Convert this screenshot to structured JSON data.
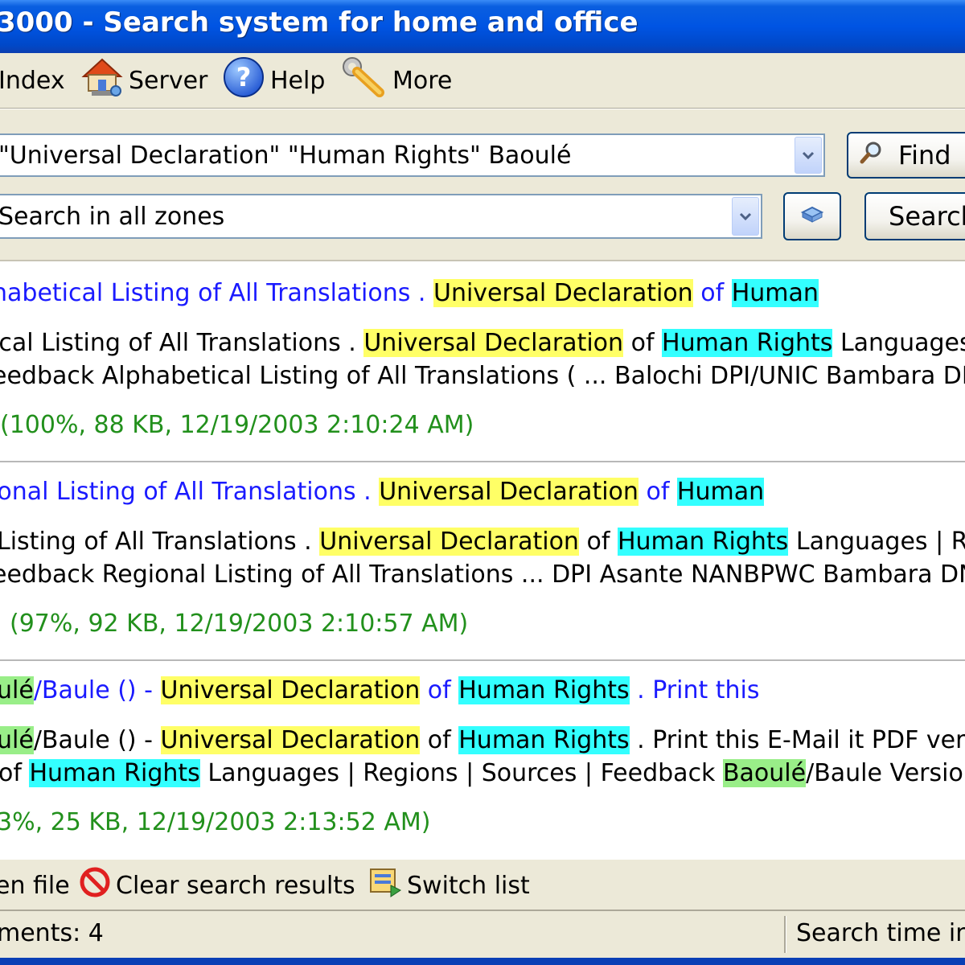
{
  "window": {
    "title": "3000 - Search system for home and office"
  },
  "toolbar": {
    "index_label": "Index",
    "server_label": "Server",
    "help_label": "Help",
    "more_label": "More"
  },
  "search": {
    "query": "\"Universal Declaration\" \"Human Rights\" Baoulé",
    "find_label": "Find",
    "zone": "Search in all zones",
    "search_label": "Search"
  },
  "results": [
    {
      "title": [
        {
          "t": "habetical Listing of All Translations . ",
          "h": ""
        },
        {
          "t": "Universal Declaration",
          "h": "y"
        },
        {
          "t": " of ",
          "h": ""
        },
        {
          "t": "Human",
          "h": "c"
        }
      ],
      "snippet1": [
        {
          "t": "ical Listing of All Translations . ",
          "h": ""
        },
        {
          "t": "Universal Declaration",
          "h": "y"
        },
        {
          "t": " of ",
          "h": ""
        },
        {
          "t": "Human Rights",
          "h": "c"
        },
        {
          "t": " Languages",
          "h": ""
        }
      ],
      "snippet2": [
        {
          "t": "eedback Alphabetical Listing of All Translations ( ... Balochi DPI/UNIC Bambara DN",
          "h": ""
        }
      ],
      "meta": "(100%, 88 KB, 12/19/2003 2:10:24 AM)"
    },
    {
      "title": [
        {
          "t": "ional Listing of All Translations . ",
          "h": ""
        },
        {
          "t": "Universal Declaration",
          "h": "y"
        },
        {
          "t": " of ",
          "h": ""
        },
        {
          "t": "Human",
          "h": "c"
        }
      ],
      "snippet1": [
        {
          "t": "Listing of All Translations . ",
          "h": ""
        },
        {
          "t": "Universal Declaration",
          "h": "y"
        },
        {
          "t": " of ",
          "h": ""
        },
        {
          "t": "Human Rights",
          "h": "c"
        },
        {
          "t": " Languages | R",
          "h": ""
        }
      ],
      "snippet2": [
        {
          "t": "eedback Regional Listing of All Translations ... DPI Asante NANBPWC Bambara DN",
          "h": ""
        }
      ],
      "meta": "(97%, 92 KB, 12/19/2003 2:10:57 AM)"
    },
    {
      "title": [
        {
          "t": "ulé",
          "h": "g"
        },
        {
          "t": "/Baule () - ",
          "h": ""
        },
        {
          "t": "Universal Declaration",
          "h": "y"
        },
        {
          "t": " of ",
          "h": ""
        },
        {
          "t": "Human Rights",
          "h": "c"
        },
        {
          "t": " . Print this",
          "h": ""
        }
      ],
      "snippet1": [
        {
          "t": "ulé",
          "h": "g"
        },
        {
          "t": "/Baule () - ",
          "h": ""
        },
        {
          "t": "Universal Declaration",
          "h": "y"
        },
        {
          "t": " of ",
          "h": ""
        },
        {
          "t": "Human Rights",
          "h": "c"
        },
        {
          "t": " . Print this E-Mail it PDF ver",
          "h": ""
        }
      ],
      "snippet2": [
        {
          "t": "of ",
          "h": ""
        },
        {
          "t": "Human Rights",
          "h": "c"
        },
        {
          "t": " Languages | Regions | Sources | Feedback ",
          "h": ""
        },
        {
          "t": "Baoulé",
          "h": "g"
        },
        {
          "t": "/Baule Versio",
          "h": ""
        }
      ],
      "meta": "3%, 25 KB, 12/19/2003 2:13:52 AM)"
    }
  ],
  "bottombar": {
    "open_file_label": "en file",
    "clear_label": "Clear search results",
    "switch_label": "Switch list"
  },
  "status": {
    "documents": "ments: 4",
    "search_time": "Search time in"
  },
  "colors": {
    "title_bar": "#0054e3",
    "result_title": "#1a1aff",
    "result_meta": "#22901c",
    "highlight_yellow": "#ffff66",
    "highlight_cyan": "#33ffff",
    "highlight_green": "#99ee88"
  }
}
